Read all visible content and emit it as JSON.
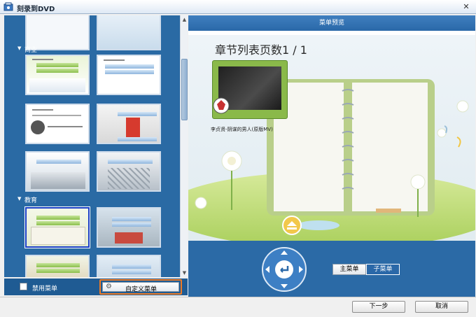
{
  "window": {
    "title": "刻录到DVD",
    "close_glyph": "✕"
  },
  "categories": [
    {
      "label": "商业"
    },
    {
      "label": "教育"
    }
  ],
  "bottom_left": {
    "disable_menu_label": "禁用菜单",
    "custom_menu_label": "自定义菜单"
  },
  "preview": {
    "header": "菜单预览",
    "page_title": "章节列表页数1 / 1",
    "chapter_caption": "李贞贤-阴谋的男人(原版MV)"
  },
  "menu_tabs": {
    "main": "主菜单",
    "sub": "子菜单"
  },
  "footer": {
    "next_label": "下一步",
    "cancel_label": "取消"
  },
  "colors": {
    "panel_blue": "#2a6aa4",
    "selection_border": "#1a3fc7",
    "highlight_orange": "#ee7b26",
    "active_tab": "#2a68a8"
  }
}
